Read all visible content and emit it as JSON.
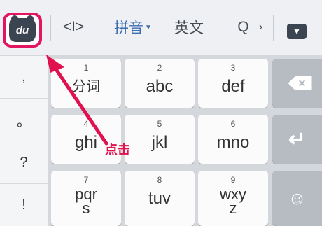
{
  "toolbar": {
    "logo_text": "du",
    "cursor_glyph": "<I>",
    "pinyin_label": "拼音",
    "english_label": "英文",
    "search_glyph": "Q",
    "more_glyph": "›",
    "collapse_glyph": "▼"
  },
  "punctuation": [
    ",",
    "。",
    "?",
    "!"
  ],
  "keys": [
    {
      "num": "1",
      "letters": "分词"
    },
    {
      "num": "2",
      "letters": "abc"
    },
    {
      "num": "3",
      "letters": "def"
    },
    {
      "num": "4",
      "letters": "ghi"
    },
    {
      "num": "5",
      "letters": "jkl"
    },
    {
      "num": "6",
      "letters": "mno"
    },
    {
      "num": "7",
      "letters": "pqr\ns"
    },
    {
      "num": "8",
      "letters": "tuv"
    },
    {
      "num": "9",
      "letters": "wxy\nz"
    }
  ],
  "func": {
    "backspace": "✕",
    "enter": "↵",
    "emoji": "☺"
  },
  "annotation": {
    "text": "点击",
    "color": "#e0114e"
  },
  "colors": {
    "highlight": "#e11560",
    "accent": "#3c6db0"
  }
}
